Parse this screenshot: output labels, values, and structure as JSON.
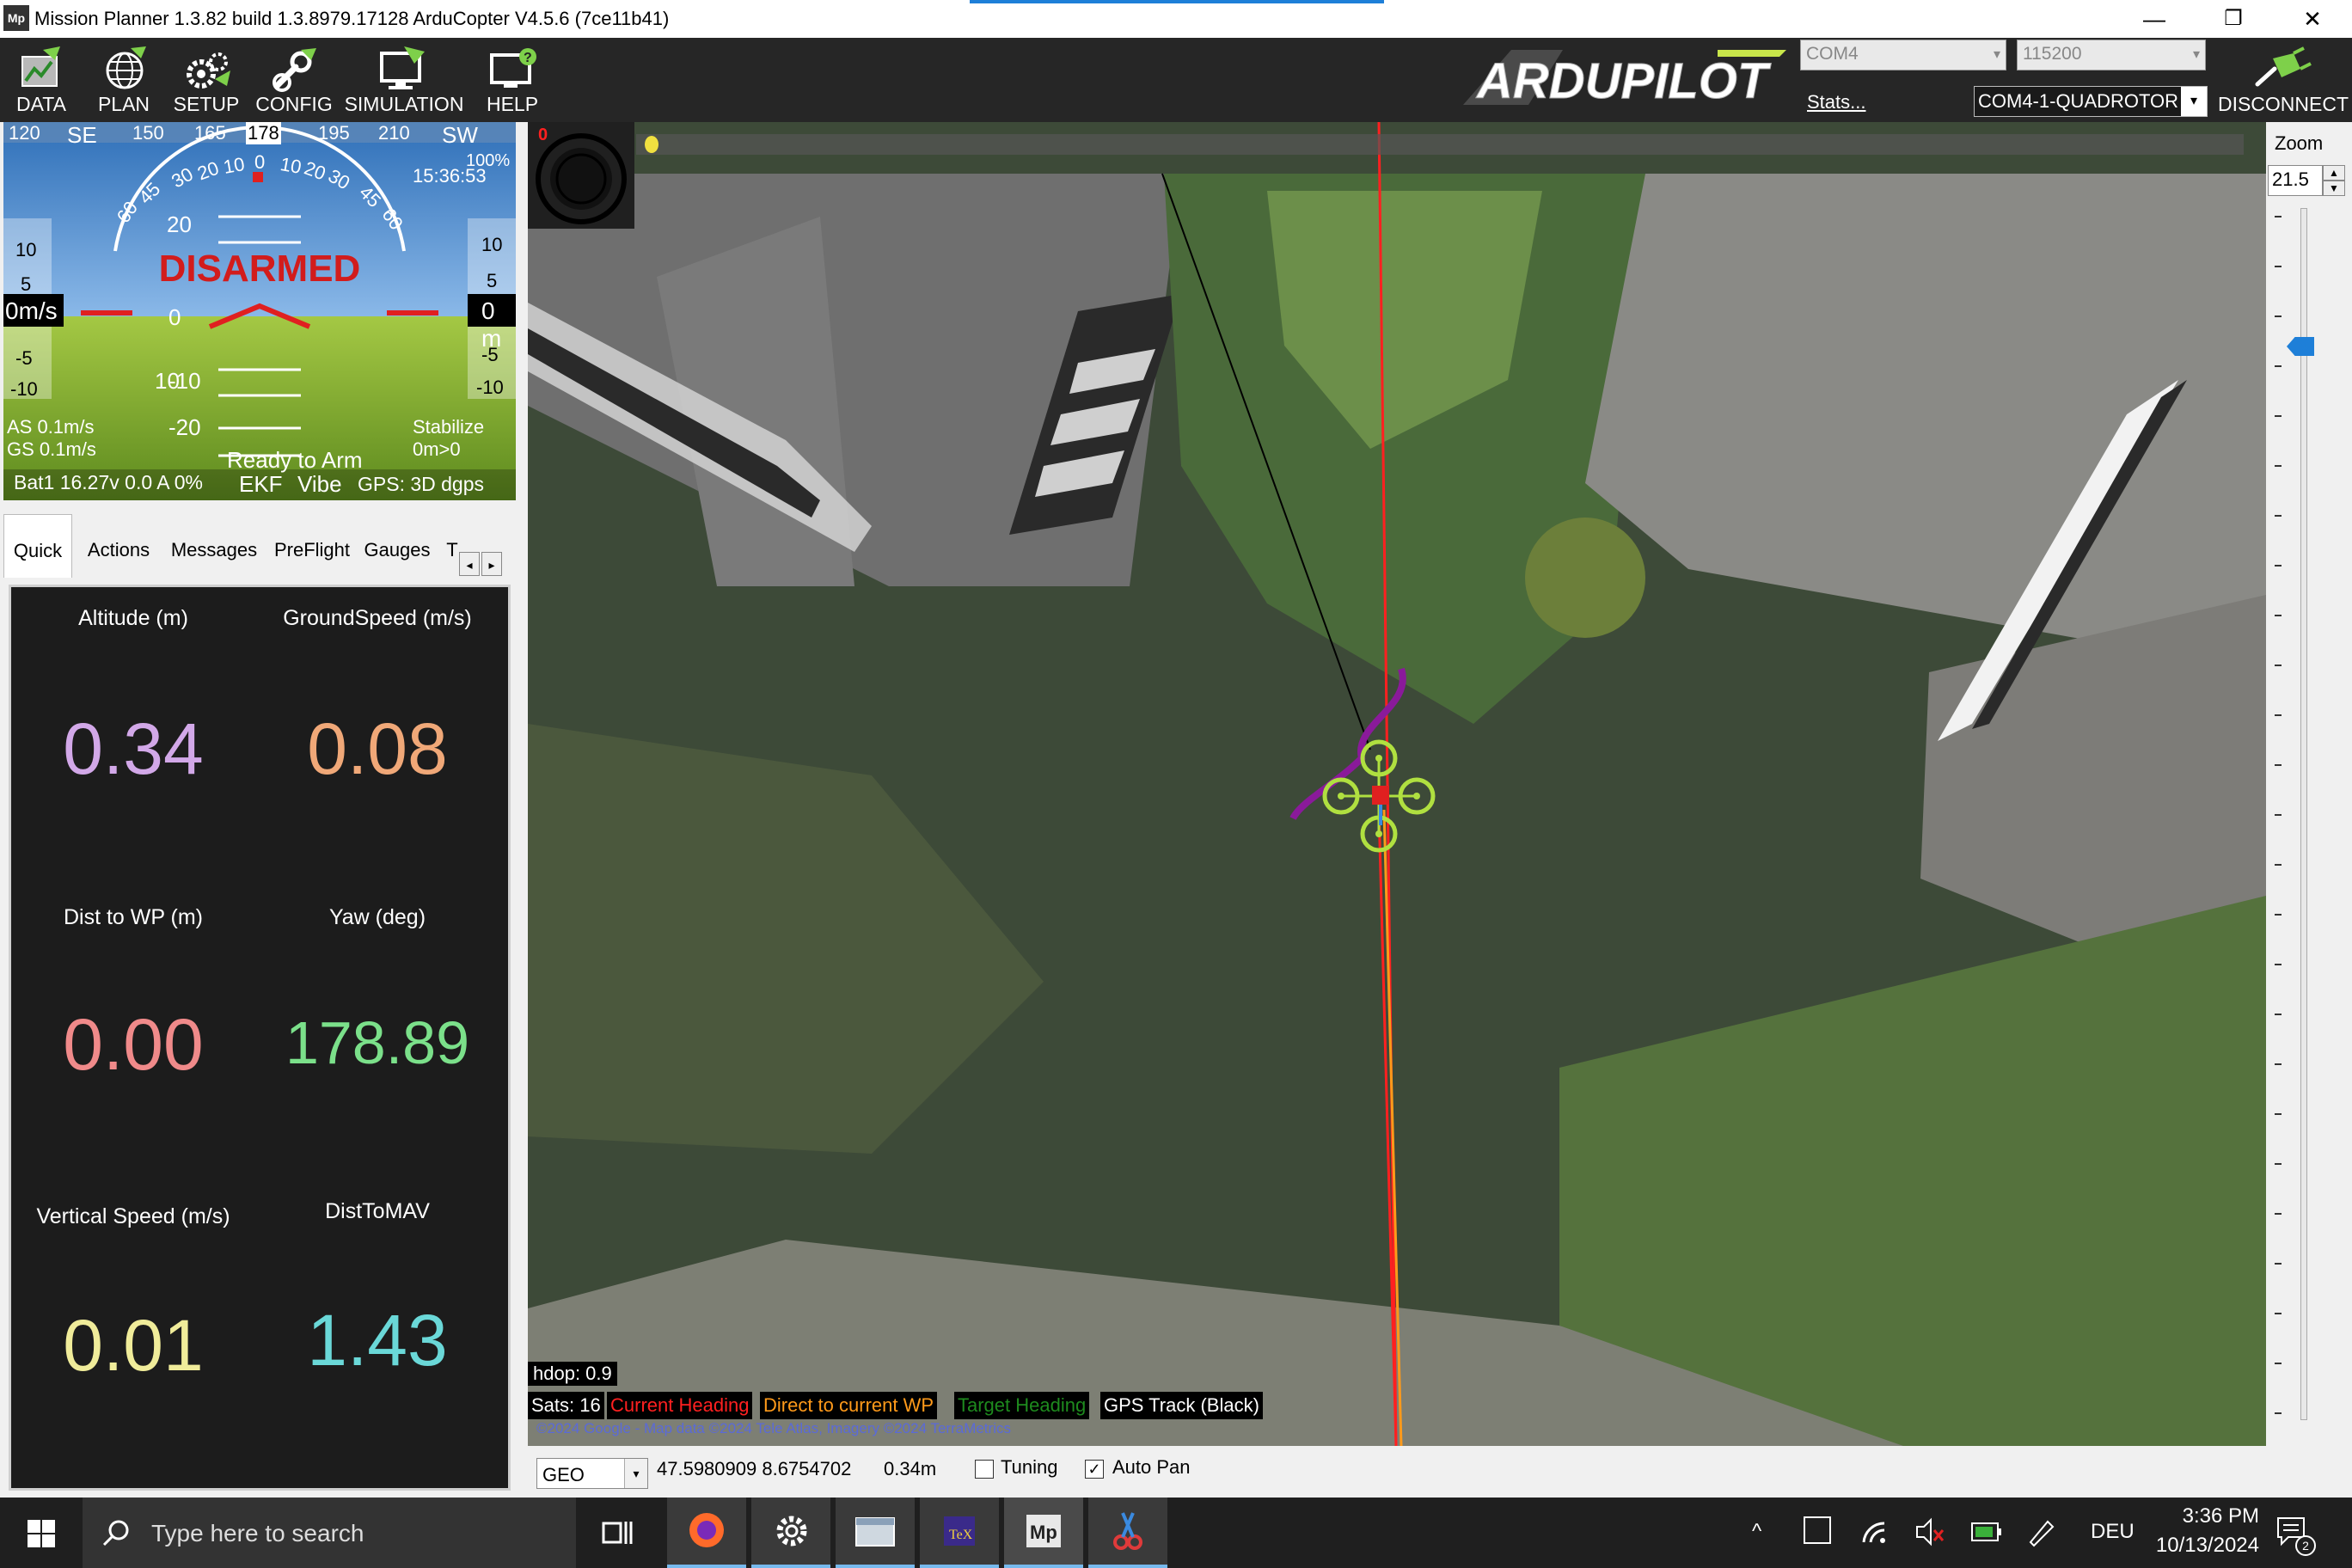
{
  "window": {
    "title": "Mission Planner 1.3.82 build 1.3.8979.17128 ArduCopter V4.5.6 (7ce11b41)",
    "app_icon": "Mp",
    "minimize": "—",
    "restore": "❐",
    "close": "✕"
  },
  "menu": {
    "items": [
      {
        "label": "DATA",
        "icon": "data-icon"
      },
      {
        "label": "PLAN",
        "icon": "plan-globe-icon"
      },
      {
        "label": "SETUP",
        "icon": "setup-gears-icon"
      },
      {
        "label": "CONFIG",
        "icon": "config-wrench-icon"
      },
      {
        "label": "SIMULATION",
        "icon": "simulation-monitor-icon"
      },
      {
        "label": "HELP",
        "icon": "help-monitor-icon"
      }
    ],
    "brand": "ARDUPILOT",
    "com_port": "COM4",
    "baud_rate": "115200",
    "stats_link": "Stats...",
    "vehicle_select": "COM4-1-QUADROTOR",
    "disconnect": "DISCONNECT"
  },
  "hud": {
    "heading_scale": [
      "120",
      "SE",
      "150",
      "165",
      "178",
      "195",
      "210",
      "SW"
    ],
    "heading_value": "178",
    "time": "15:36:53",
    "percent": "100%",
    "status": "DISARMED",
    "pitch_labels": [
      "20",
      "10",
      "0",
      "-10",
      "-20"
    ],
    "roll_labels": [
      "60",
      "45",
      "30",
      "20",
      "10",
      "0",
      "10",
      "20",
      "30",
      "45",
      "60"
    ],
    "speed_tape": [
      "10",
      "5",
      "0m/s",
      "-5",
      "-10"
    ],
    "alt_tape": [
      "10",
      "5",
      "0 m",
      "-5",
      "-10"
    ],
    "airspeed": "AS 0.1m/s",
    "groundspeed": "GS 0.1m/s",
    "mode": "Stabilize",
    "wp_info": "0m>0",
    "ready": "Ready to Arm",
    "battery": "Bat1 16.27v 0.0 A 0%",
    "ekf": "EKF",
    "vibe": "Vibe",
    "gps": "GPS: 3D dgps",
    "colors": {
      "sky": "#4a86c5",
      "ground": "#8fb83a",
      "status_red": "#d21c1c"
    }
  },
  "tabs": [
    "Quick",
    "Actions",
    "Messages",
    "PreFlight",
    "Gauges",
    "T"
  ],
  "quick": [
    {
      "label": "Altitude (m)",
      "value": "0.34",
      "color": "#d2a8e8"
    },
    {
      "label": "GroundSpeed (m/s)",
      "value": "0.08",
      "color": "#f0a878"
    },
    {
      "label": "Dist to WP (m)",
      "value": "0.00",
      "color": "#f08a8a"
    },
    {
      "label": "Yaw (deg)",
      "value": "178.89",
      "color": "#7be08a"
    },
    {
      "label": "Vertical Speed (m/s)",
      "value": "0.01",
      "color": "#f0ec9a"
    },
    {
      "label": "DistToMAV",
      "value": "1.43",
      "color": "#6ad8d8"
    }
  ],
  "map": {
    "overlay_counter": "0",
    "hdop": "hdop: 0.9",
    "sats": "Sats: 16",
    "legend": [
      {
        "label": "Current Heading",
        "color": "#ff2020"
      },
      {
        "label": "Direct to current WP",
        "color": "#ff9a1a"
      },
      {
        "label": "Target Heading",
        "color": "#1e8a1e"
      },
      {
        "label": "GPS Track (Black)",
        "color": "#ffffff"
      }
    ],
    "copyright": "©2024 Google - Map data ©2024 Tele Atlas, Imagery ©2024 TerraMetrics"
  },
  "zoom": {
    "label": "Zoom",
    "value": "21.5"
  },
  "statusbar": {
    "coord_system": "GEO",
    "coords": "47.5980909 8.6754702",
    "alt": "0.34m",
    "tuning_label": "Tuning",
    "tuning_checked": false,
    "autopan_label": "Auto Pan",
    "autopan_checked": true
  },
  "taskbar": {
    "search_placeholder": "Type here to search",
    "lang": "DEU",
    "time": "3:36 PM",
    "date": "10/13/2024",
    "notification_count": "2"
  }
}
